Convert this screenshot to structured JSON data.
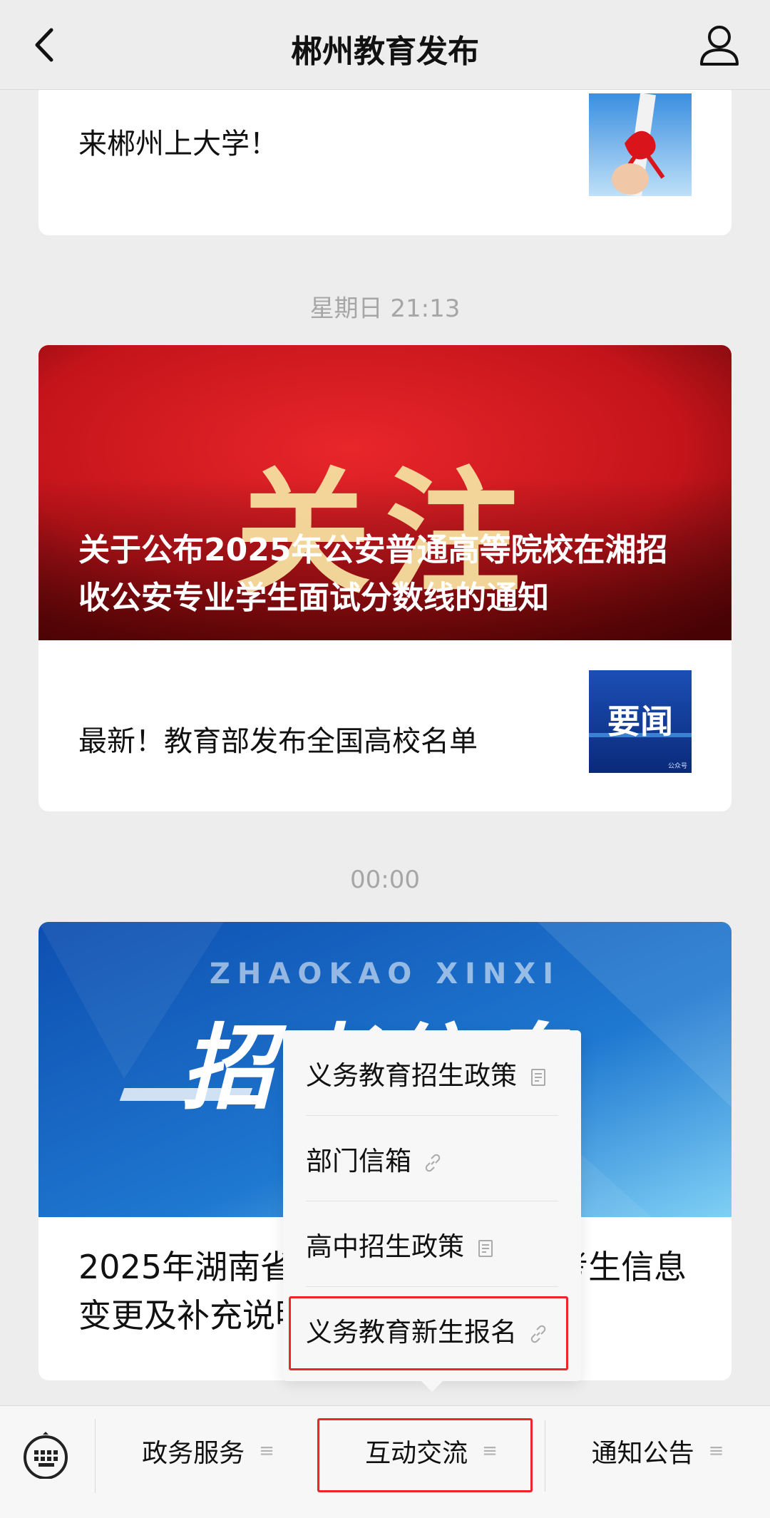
{
  "header": {
    "title": "郴州教育发布"
  },
  "feed": {
    "card1": {
      "text": "来郴州上大学！"
    },
    "time1": "星期日 21:13",
    "card2": {
      "cover_banner": "关注",
      "cover_title": "关于公布2025年公安普通高等院校在湘招收公安专业学生面试分数线的通知",
      "item_text": "最新！教育部发布全国高校名单",
      "item_thumb_label": "要闻",
      "item_thumb_small": "公众号"
    },
    "time2": "00:00",
    "card3": {
      "banner_en": "ZHAOKAO XINXI",
      "banner_cn": "招考信息",
      "title": "2025年湖南省普通高校招生考试考生信息变更及补充说明（6"
    }
  },
  "popup_menu": {
    "items": [
      {
        "label": "义务教育招生政策",
        "icon": "article-icon"
      },
      {
        "label": "部门信箱",
        "icon": "link-icon"
      },
      {
        "label": "高中招生政策",
        "icon": "article-icon"
      },
      {
        "label": "义务教育新生报名",
        "icon": "link-icon",
        "highlighted": true
      }
    ]
  },
  "bottom_menu": {
    "tabs": [
      {
        "label": "政务服务"
      },
      {
        "label": "互动交流",
        "highlighted": true
      },
      {
        "label": "通知公告"
      }
    ]
  },
  "colors": {
    "highlight": "#e8262b",
    "cover_red": "#c4141a",
    "banner_blue": "#1f78d0"
  }
}
